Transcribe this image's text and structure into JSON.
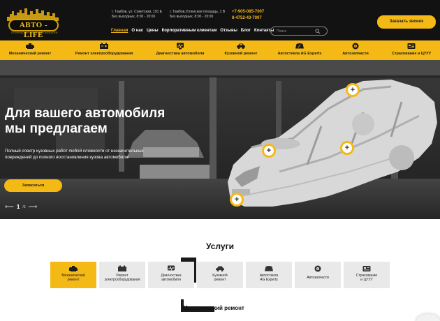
{
  "header": {
    "logo_text": "АВТО - LIFE",
    "logo_tagline": "ТЕХНИЧЕСКИЙ ЦЕНТР АВТОМОБИЛЕЙ",
    "address1_line1": "г. Тамбов, ул. Советская, 191 Е",
    "address1_line2": "Без выходных, 8:00 - 20:00",
    "address2_line1": "г. Тамбов,Успенская площадь, 1 В",
    "address2_line2": "Без выходных, 8:00 - 20:00",
    "phone1": "+7-905-085-7007",
    "phone2": "8-4752-43-7007",
    "nav": [
      "Главная",
      "О нас",
      "Цены",
      "Корпоративным клиентам",
      "Отзывы",
      "Блог",
      "Контакты"
    ],
    "search_placeholder": "Поиск",
    "callback_label": "Заказать звонок"
  },
  "categories": [
    {
      "label": "Механический ремонт",
      "icon": "engine-icon"
    },
    {
      "label": "Ремонт электрооборудования",
      "icon": "battery-icon"
    },
    {
      "label": "Диагностика автомобиля",
      "icon": "diagnostics-icon"
    },
    {
      "label": "Кузовной ремонт",
      "icon": "car-body-icon"
    },
    {
      "label": "Автостекла AG Experts",
      "icon": "windshield-icon"
    },
    {
      "label": "Автозапчасти",
      "icon": "wheel-icon"
    },
    {
      "label": "Страхование и ЦУУУ",
      "icon": "insurance-icon"
    }
  ],
  "hero": {
    "title_line1": "Для вашего автомобиля",
    "title_line2": "мы предлагаем",
    "subtitle_line1": "Полный спектр кузовных работ любой сложности от незначительных",
    "subtitle_line2": "повреждений до полного восстановления кузова автомобиля!",
    "signup_label": "Записаться",
    "slide_current": "1",
    "slide_total": "/3",
    "hotspot_symbol": "+"
  },
  "services": {
    "title": "Услуги",
    "tiles": [
      {
        "label_line1": "Механический",
        "label_line2": "ремонт",
        "icon": "engine-icon"
      },
      {
        "label_line1": "Ремонт",
        "label_line2": "электрооборудования",
        "icon": "battery-icon"
      },
      {
        "label_line1": "Диагностика",
        "label_line2": "автомобиля",
        "icon": "diagnostics-icon"
      },
      {
        "label_line1": "Кузовной",
        "label_line2": "ремонт",
        "icon": "car-body-icon"
      },
      {
        "label_line1": "Автостекла",
        "label_line2": "AG Experts",
        "icon": "windshield-icon"
      },
      {
        "label_line1": "Автозапчасти",
        "label_line2": "",
        "icon": "wheel-icon"
      },
      {
        "label_line1": "Страхование",
        "label_line2": "и ЦУУУ",
        "icon": "insurance-icon"
      }
    ],
    "section_heading": "Механический ремонт"
  },
  "colors": {
    "accent": "#f5b915",
    "header_bg": "#121212",
    "tile_bg": "#e9e9e9"
  }
}
